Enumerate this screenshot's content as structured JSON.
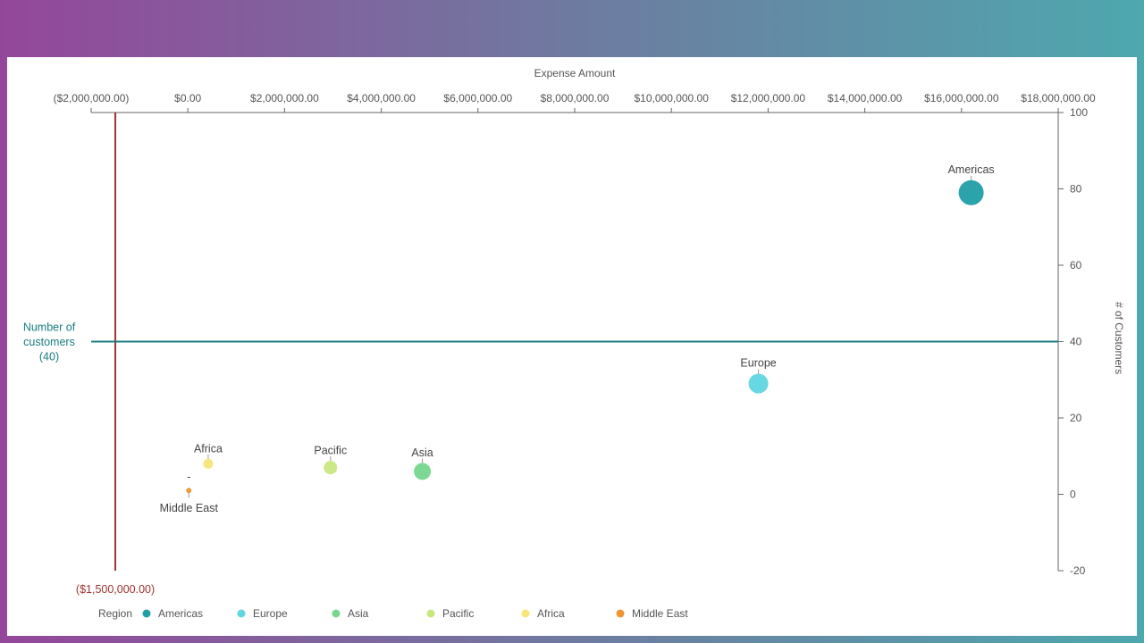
{
  "chart_data": {
    "type": "scatter",
    "xlabel": "Expense Amount",
    "ylabel": "# of Customers",
    "xlim": [
      -2000000,
      18000000
    ],
    "ylim": [
      -20,
      100
    ],
    "x_ticks": [
      -2000000,
      0,
      2000000,
      4000000,
      6000000,
      8000000,
      10000000,
      12000000,
      14000000,
      16000000,
      18000000
    ],
    "x_tick_labels": [
      "($2,000,000.00)",
      "$0.00",
      "$2,000,000.00",
      "$4,000,000.00",
      "$6,000,000.00",
      "$8,000,000.00",
      "$10,000,000.00",
      "$12,000,000.00",
      "$14,000,000.00",
      "$16,000,000.00",
      "$18,000,000.00"
    ],
    "y_ticks": [
      -20,
      0,
      20,
      40,
      60,
      80,
      100
    ],
    "y_tick_labels": [
      "-20",
      "0",
      "20",
      "40",
      "60",
      "80",
      "100"
    ],
    "legend_title": "Region",
    "legend_position": "bottom",
    "series": [
      {
        "name": "Americas",
        "color": "#219ea6",
        "x": 16200000,
        "y": 79,
        "size": 14
      },
      {
        "name": "Europe",
        "color": "#5fd6e0",
        "x": 11800000,
        "y": 29,
        "size": 11
      },
      {
        "name": "Asia",
        "color": "#76d68e",
        "x": 4850000,
        "y": 6,
        "size": 9.5
      },
      {
        "name": "Pacific",
        "color": "#c8e87f",
        "x": 2950000,
        "y": 7,
        "size": 7.5
      },
      {
        "name": "Africa",
        "color": "#f7e47a",
        "x": 420000,
        "y": 8,
        "size": 5.5
      },
      {
        "name": "Middle East",
        "color": "#ef9433",
        "x": 20000,
        "y": 1,
        "size": 3
      }
    ],
    "point_labels": [
      {
        "text": "Americas",
        "series": "Americas"
      },
      {
        "text": "Europe",
        "series": "Europe"
      },
      {
        "text": "Asia",
        "series": "Asia"
      },
      {
        "text": "Pacific",
        "series": "Pacific"
      },
      {
        "text": "Africa",
        "series": "Africa"
      },
      {
        "text": "Middle East",
        "series": "Middle East"
      },
      {
        "text": "-",
        "series": "Middle East"
      }
    ],
    "reference_lines": [
      {
        "axis": "x",
        "value": -1500000,
        "label": "($1,500,000.00)",
        "color": "#a33030"
      },
      {
        "axis": "y",
        "value": 40,
        "label_lines": [
          "Number of",
          "customers",
          "(40)"
        ],
        "color": "#1a7c80"
      }
    ]
  }
}
